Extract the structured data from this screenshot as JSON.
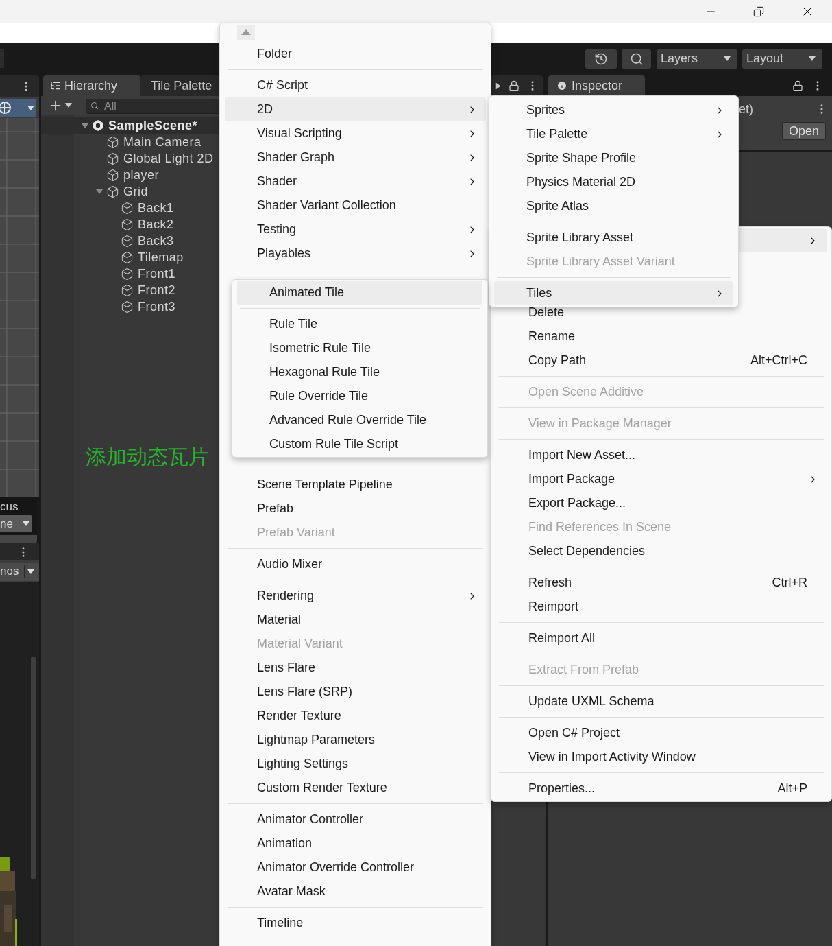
{
  "toolbar": {
    "layers": "Layers",
    "layout": "Layout"
  },
  "scene_panel": {
    "overlay_label": "cus",
    "overlay_dropdown": "ne",
    "gizmos_dropdown": "nos"
  },
  "hierarchy": {
    "tabs": [
      {
        "label": "Hierarchy",
        "selected": true
      },
      {
        "label": "Tile Palette",
        "selected": false
      }
    ],
    "search_placeholder": "All",
    "tree": [
      {
        "label": "SampleScene*",
        "kind": "scene",
        "expanded": true,
        "children": [
          {
            "label": "Main Camera",
            "kind": "object"
          },
          {
            "label": "Global Light 2D",
            "kind": "object"
          },
          {
            "label": "player",
            "kind": "object"
          },
          {
            "label": "Grid",
            "kind": "object",
            "expanded": true,
            "children": [
              {
                "label": "Back1",
                "kind": "object"
              },
              {
                "label": "Back2",
                "kind": "object"
              },
              {
                "label": "Back3",
                "kind": "object"
              },
              {
                "label": "Tilemap",
                "kind": "object"
              },
              {
                "label": "Front1",
                "kind": "object"
              },
              {
                "label": "Front2",
                "kind": "object"
              },
              {
                "label": "Front3",
                "kind": "object"
              }
            ]
          }
        ]
      }
    ]
  },
  "annotation": "添加动态瓦片",
  "inspector": {
    "tab": "Inspector",
    "title_fragment": "et)",
    "open_button": "Open"
  },
  "create_menu": {
    "items_above": [
      {
        "kind": "item",
        "label": "Folder",
        "submenu": false,
        "disabled": false,
        "selected": false
      },
      {
        "kind": "separator"
      },
      {
        "kind": "item",
        "label": "C# Script",
        "submenu": false,
        "disabled": false,
        "selected": false
      },
      {
        "kind": "item",
        "label": "2D",
        "submenu": true,
        "disabled": false,
        "selected": true
      },
      {
        "kind": "item",
        "label": "Visual Scripting",
        "submenu": true,
        "disabled": false,
        "selected": false
      },
      {
        "kind": "item",
        "label": "Shader Graph",
        "submenu": true,
        "disabled": false,
        "selected": false
      },
      {
        "kind": "item",
        "label": "Shader",
        "submenu": true,
        "disabled": false,
        "selected": false
      },
      {
        "kind": "item",
        "label": "Shader Variant Collection",
        "submenu": false,
        "disabled": false,
        "selected": false
      },
      {
        "kind": "item",
        "label": "Testing",
        "submenu": true,
        "disabled": false,
        "selected": false
      },
      {
        "kind": "item",
        "label": "Playables",
        "submenu": true,
        "disabled": false,
        "selected": false
      }
    ],
    "items_below": [
      {
        "kind": "item",
        "label": "Scene Template Pipeline",
        "submenu": false,
        "disabled": false,
        "selected": false
      },
      {
        "kind": "item",
        "label": "Prefab",
        "submenu": false,
        "disabled": false,
        "selected": false
      },
      {
        "kind": "item",
        "label": "Prefab Variant",
        "submenu": false,
        "disabled": true,
        "selected": false
      },
      {
        "kind": "separator"
      },
      {
        "kind": "item",
        "label": "Audio Mixer",
        "submenu": false,
        "disabled": false,
        "selected": false
      },
      {
        "kind": "separator"
      },
      {
        "kind": "item",
        "label": "Rendering",
        "submenu": true,
        "disabled": false,
        "selected": false
      },
      {
        "kind": "item",
        "label": "Material",
        "submenu": false,
        "disabled": false,
        "selected": false
      },
      {
        "kind": "item",
        "label": "Material Variant",
        "submenu": false,
        "disabled": true,
        "selected": false
      },
      {
        "kind": "item",
        "label": "Lens Flare",
        "submenu": false,
        "disabled": false,
        "selected": false
      },
      {
        "kind": "item",
        "label": "Lens Flare (SRP)",
        "submenu": false,
        "disabled": false,
        "selected": false
      },
      {
        "kind": "item",
        "label": "Render Texture",
        "submenu": false,
        "disabled": false,
        "selected": false
      },
      {
        "kind": "item",
        "label": "Lightmap Parameters",
        "submenu": false,
        "disabled": false,
        "selected": false
      },
      {
        "kind": "item",
        "label": "Lighting Settings",
        "submenu": false,
        "disabled": false,
        "selected": false
      },
      {
        "kind": "item",
        "label": "Custom Render Texture",
        "submenu": false,
        "disabled": false,
        "selected": false
      },
      {
        "kind": "separator"
      },
      {
        "kind": "item",
        "label": "Animator Controller",
        "submenu": false,
        "disabled": false,
        "selected": false
      },
      {
        "kind": "item",
        "label": "Animation",
        "submenu": false,
        "disabled": false,
        "selected": false
      },
      {
        "kind": "item",
        "label": "Animator Override Controller",
        "submenu": false,
        "disabled": false,
        "selected": false
      },
      {
        "kind": "item",
        "label": "Avatar Mask",
        "submenu": false,
        "disabled": false,
        "selected": false
      },
      {
        "kind": "separator"
      },
      {
        "kind": "item",
        "label": "Timeline",
        "submenu": false,
        "disabled": false,
        "selected": false
      }
    ]
  },
  "submenu_2d": {
    "items": [
      {
        "kind": "item",
        "label": "Sprites",
        "submenu": true,
        "disabled": false,
        "selected": false
      },
      {
        "kind": "item",
        "label": "Tile Palette",
        "submenu": true,
        "disabled": false,
        "selected": false
      },
      {
        "kind": "item",
        "label": "Sprite Shape Profile",
        "submenu": false,
        "disabled": false,
        "selected": false
      },
      {
        "kind": "item",
        "label": "Physics Material 2D",
        "submenu": false,
        "disabled": false,
        "selected": false
      },
      {
        "kind": "item",
        "label": "Sprite Atlas",
        "submenu": false,
        "disabled": false,
        "selected": false
      },
      {
        "kind": "separator"
      },
      {
        "kind": "item",
        "label": "Sprite Library Asset",
        "submenu": false,
        "disabled": false,
        "selected": false
      },
      {
        "kind": "item",
        "label": "Sprite Library Asset Variant",
        "submenu": false,
        "disabled": true,
        "selected": false
      },
      {
        "kind": "separator"
      },
      {
        "kind": "item",
        "label": "Tiles",
        "submenu": true,
        "disabled": false,
        "selected": true
      }
    ]
  },
  "submenu_tiles": {
    "items": [
      {
        "kind": "item",
        "label": "Animated Tile",
        "submenu": false,
        "disabled": false,
        "selected": true
      },
      {
        "kind": "separator"
      },
      {
        "kind": "item",
        "label": "Rule Tile",
        "submenu": false,
        "disabled": false,
        "selected": false
      },
      {
        "kind": "item",
        "label": "Isometric Rule Tile",
        "submenu": false,
        "disabled": false,
        "selected": false
      },
      {
        "kind": "item",
        "label": "Hexagonal Rule Tile",
        "submenu": false,
        "disabled": false,
        "selected": false
      },
      {
        "kind": "item",
        "label": "Rule Override Tile",
        "submenu": false,
        "disabled": false,
        "selected": false
      },
      {
        "kind": "item",
        "label": "Advanced Rule Override Tile",
        "submenu": false,
        "disabled": false,
        "selected": false
      },
      {
        "kind": "item",
        "label": "Custom Rule Tile Script",
        "submenu": false,
        "disabled": false,
        "selected": false
      }
    ]
  },
  "context_menu": {
    "covered_row": {
      "submenu": true,
      "selected": true
    },
    "items": [
      {
        "kind": "item",
        "label": "Delete",
        "submenu": false,
        "disabled": false,
        "selected": false
      },
      {
        "kind": "item",
        "label": "Rename",
        "submenu": false,
        "disabled": false,
        "selected": false
      },
      {
        "kind": "item",
        "label": "Copy Path",
        "shortcut": "Alt+Ctrl+C",
        "submenu": false,
        "disabled": false,
        "selected": false
      },
      {
        "kind": "separator"
      },
      {
        "kind": "item",
        "label": "Open Scene Additive",
        "submenu": false,
        "disabled": true,
        "selected": false
      },
      {
        "kind": "separator"
      },
      {
        "kind": "item",
        "label": "View in Package Manager",
        "submenu": false,
        "disabled": true,
        "selected": false
      },
      {
        "kind": "separator"
      },
      {
        "kind": "item",
        "label": "Import New Asset...",
        "submenu": false,
        "disabled": false,
        "selected": false
      },
      {
        "kind": "item",
        "label": "Import Package",
        "submenu": true,
        "disabled": false,
        "selected": false
      },
      {
        "kind": "item",
        "label": "Export Package...",
        "submenu": false,
        "disabled": false,
        "selected": false
      },
      {
        "kind": "item",
        "label": "Find References In Scene",
        "submenu": false,
        "disabled": true,
        "selected": false
      },
      {
        "kind": "item",
        "label": "Select Dependencies",
        "submenu": false,
        "disabled": false,
        "selected": false
      },
      {
        "kind": "separator"
      },
      {
        "kind": "item",
        "label": "Refresh",
        "shortcut": "Ctrl+R",
        "submenu": false,
        "disabled": false,
        "selected": false
      },
      {
        "kind": "item",
        "label": "Reimport",
        "submenu": false,
        "disabled": false,
        "selected": false
      },
      {
        "kind": "separator"
      },
      {
        "kind": "item",
        "label": "Reimport All",
        "submenu": false,
        "disabled": false,
        "selected": false
      },
      {
        "kind": "separator"
      },
      {
        "kind": "item",
        "label": "Extract From Prefab",
        "submenu": false,
        "disabled": true,
        "selected": false
      },
      {
        "kind": "separator"
      },
      {
        "kind": "item",
        "label": "Update UXML Schema",
        "submenu": false,
        "disabled": false,
        "selected": false
      },
      {
        "kind": "separator"
      },
      {
        "kind": "item",
        "label": "Open C# Project",
        "submenu": false,
        "disabled": false,
        "selected": false
      },
      {
        "kind": "item",
        "label": "View in Import Activity Window",
        "submenu": false,
        "disabled": false,
        "selected": false
      },
      {
        "kind": "separator"
      },
      {
        "kind": "item",
        "label": "Properties...",
        "shortcut": "Alt+P",
        "submenu": false,
        "disabled": false,
        "selected": false
      }
    ]
  }
}
